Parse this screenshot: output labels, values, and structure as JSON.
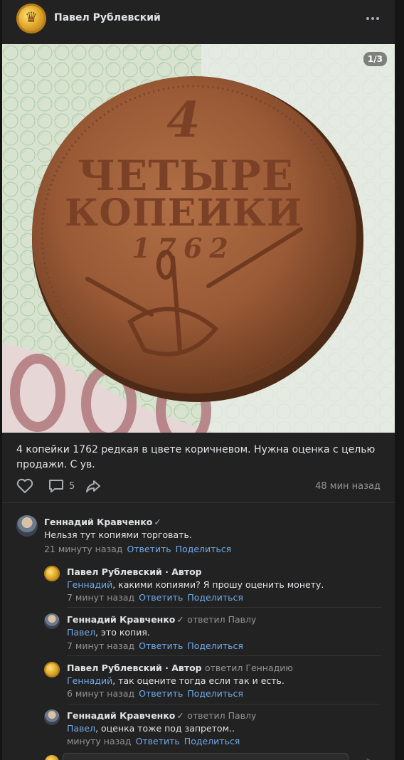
{
  "post": {
    "author": "Павел Рублевский",
    "photo_counter": "1/3",
    "coin": {
      "value": "4",
      "line1": "ЧЕТЫРЕ",
      "line2": "КОПЕИКИ",
      "year": "1762"
    },
    "text": "4 копейки 1762 редкая в цвете коричневом. Нужна оценка с целью продажи. С ув.",
    "comments_count": "5",
    "time": "48 мин назад"
  },
  "comments": [
    {
      "author": "Геннадий Кравченко",
      "verified": "✓",
      "text": "Нельзя тут копиями торговать.",
      "time": "21 минуту назад",
      "reply": "Ответить",
      "share": "Поделиться"
    },
    {
      "author": "Павел Рублевский · Автор",
      "mention": "Геннадий",
      "text": ", какими копиями? Я прошу оценить монету.",
      "time": "7 минут назад",
      "reply": "Ответить",
      "share": "Поделиться"
    },
    {
      "author": "Геннадий Кравченко",
      "verified": "✓",
      "replied_to": "ответил Павлу",
      "mention": "Павел",
      "text": ", это копия.",
      "time": "7 минут назад",
      "reply": "Ответить",
      "share": "Поделиться"
    },
    {
      "author": "Павел Рублевский · Автор",
      "replied_to": "ответил Геннадию",
      "mention": "Геннадий",
      "text": ", так оцените тогда если так и есть.",
      "time": "6 минут назад",
      "reply": "Ответить",
      "share": "Поделиться"
    },
    {
      "author": "Геннадий Кравченко",
      "verified": "✓",
      "replied_to": "ответил Павлу",
      "mention": "Павел",
      "text": ", оценка тоже под запретом..",
      "time": "минуту назад",
      "reply": "Ответить",
      "share": "Поделиться"
    }
  ]
}
